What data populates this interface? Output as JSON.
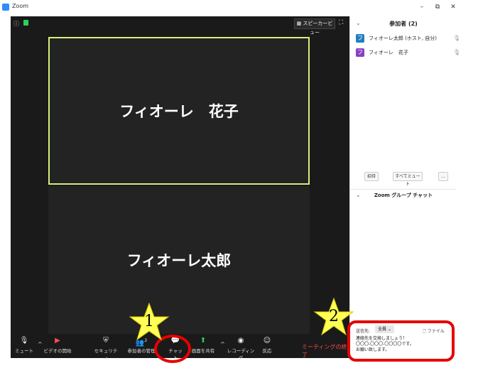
{
  "window": {
    "title": "Zoom",
    "controls": [
      "–",
      "⧉",
      "✕"
    ]
  },
  "video": {
    "speaker_view_label": "スピーカービュー",
    "tiles": [
      {
        "name": "フィオーレ　花子",
        "active": true
      },
      {
        "name": "フィオーレ太郎",
        "active": false
      }
    ]
  },
  "toolbar": {
    "mute": "ミュート",
    "start_video": "ビデオの開始",
    "security": "セキュリティ",
    "participants": "参加者の管理",
    "participants_count": "2",
    "chat": "チャット",
    "share_screen": "画面を共有",
    "record": "レコーディング",
    "reactions": "反応",
    "end_meeting": "ミーティングの終了"
  },
  "sidebar": {
    "participants_title": "参加者 (2)",
    "participants": [
      {
        "name": "フィオーレ太郎 (ホスト, 自分)",
        "initial": "フ",
        "color": "#1f7fc1"
      },
      {
        "name": "フィオーレ　花子",
        "initial": "フ",
        "color": "#8a3fc4"
      }
    ],
    "invite": "招待",
    "mute_all": "すべてミュート",
    "more": "...",
    "chat_title": "Zoom グループ チャット",
    "send_to_label": "送信先:",
    "send_to_value": "全員",
    "file": "ファイル",
    "message": "連絡先を交換しましょう！\n〇〇〇-〇〇〇-〇〇〇〇です。\nお願い致します。"
  },
  "annotations": {
    "star1": "1",
    "star2": "2",
    "highlight_color": "#e60000",
    "star_color": "#ffff55"
  }
}
